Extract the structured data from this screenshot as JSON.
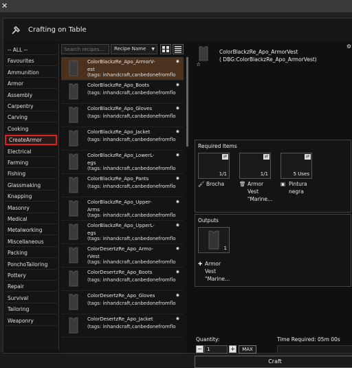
{
  "window": {
    "title": "Crafting on Table"
  },
  "categories": [
    "-- ALL --",
    "Favourites",
    "Ammunition",
    "Armor",
    "Assembly",
    "Carpentry",
    "Carving",
    "Cooking",
    "CreateArmor",
    "Electrical",
    "Farming",
    "Fishing",
    "Glassmaking",
    "Knapping",
    "Masonry",
    "Medical",
    "Metalworking",
    "Miscellaneous",
    "Packing",
    "PonchoTailoring",
    "Pottery",
    "Repair",
    "Survival",
    "Tailoring",
    "Weaponry"
  ],
  "selected_category_index": 8,
  "search": {
    "placeholder": "Search recipes...",
    "sort_value": "Recipe Name"
  },
  "recipes": [
    {
      "name": "ColorBlackzRe_Apo_ArmorV-\nest",
      "tags": "(tags: inhandcraft,canbedonefromflo",
      "selected": true
    },
    {
      "name": "ColorBlackzRe_Apo_Boots",
      "tags": "(tags: inhandcraft,canbedonefromflo"
    },
    {
      "name": "ColorBlackzRe_Apo_Gloves",
      "tags": "(tags: inhandcraft,canbedonefromflo"
    },
    {
      "name": "ColorBlackzRe_Apo_Jacket",
      "tags": "(tags: inhandcraft,canbedonefromflo"
    },
    {
      "name": "ColorBlackzRe_Apo_LowerL-\negs",
      "tags": "(tags: inhandcraft,canbedonefromflo"
    },
    {
      "name": "ColorBlackzRe_Apo_Pants",
      "tags": "(tags: inhandcraft,canbedonefromflo"
    },
    {
      "name": "ColorBlackzRe_Apo_Upper-\nArms",
      "tags": "(tags: inhandcraft,canbedonefromflo"
    },
    {
      "name": "ColorBlackzRe_Apo_UpperL-\negs",
      "tags": "(tags: inhandcraft,canbedonefromflo"
    },
    {
      "name": "ColorDesertzRe_Apo_Armo-\nrVest",
      "tags": "(tags: inhandcraft,canbedonefromflo"
    },
    {
      "name": "ColorDesertzRe_Apo_Boots",
      "tags": "(tags: inhandcraft,canbedonefromflo"
    },
    {
      "name": "ColorDesertzRe_Apo_Gloves",
      "tags": "(tags: inhandcraft,canbedonefromflo"
    },
    {
      "name": "ColorDesertzRe_Apo_Jacket",
      "tags": "(tags: inhandcraft,canbedonefromflo"
    }
  ],
  "detail": {
    "name": "ColorBlackzRe_Apo_ArmorVest",
    "sub": "( DBG:ColorBlackzRe_Apo_ArmorVest)",
    "required_title": "Required Items",
    "required": [
      {
        "count": "1/1",
        "label": "Brocha",
        "icon": "brush-icon"
      },
      {
        "count": "1/1",
        "label": "Armor\nVest\n\"Marine...",
        "icon": "trash-icon"
      },
      {
        "count": "5 Uses",
        "label": "Pintura\nnegra",
        "icon": "paint-can-icon"
      }
    ],
    "outputs_title": "Outputs",
    "output": {
      "count": "1",
      "label": "Armor\nVest\n\"Marine..."
    }
  },
  "footer": {
    "quantity_label": "Quantity:",
    "quantity_value": "1",
    "minus": "−",
    "plus": "+",
    "max_label": "MAX",
    "time_label": "Time Required: 05m 00s",
    "craft_label": "Craft"
  },
  "colors": {
    "selected_row": "#4b321f",
    "highlight_border": "#e02020"
  }
}
